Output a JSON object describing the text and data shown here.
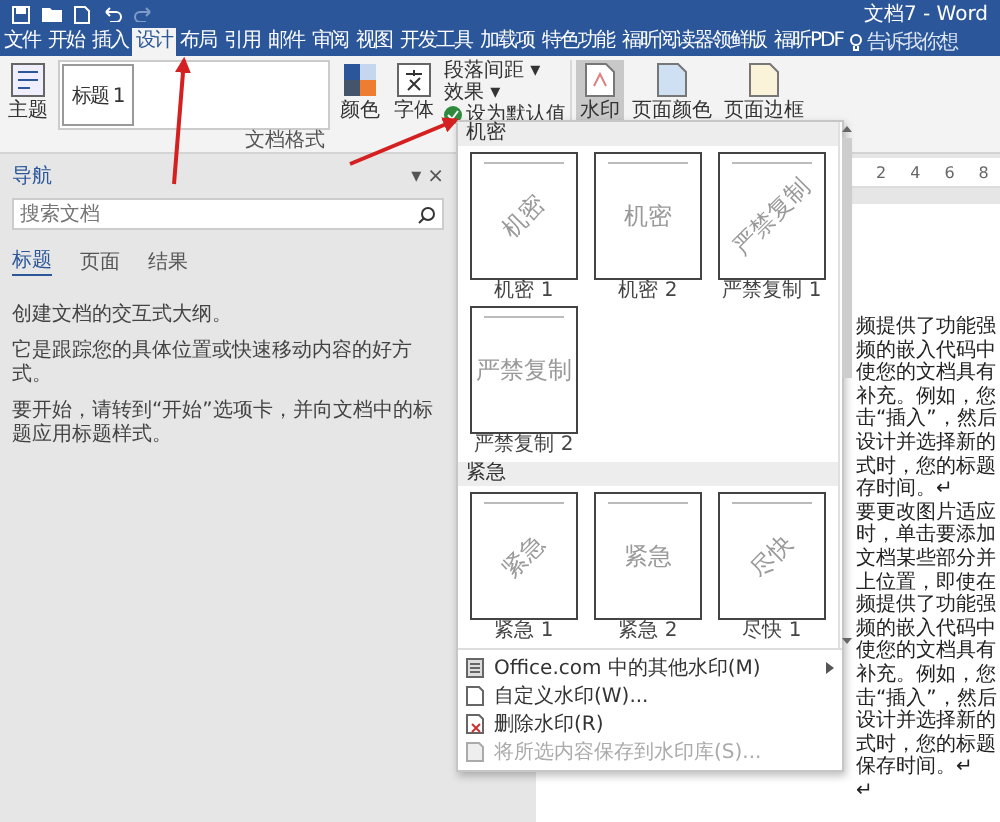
{
  "window": {
    "title": "文档7 - Word"
  },
  "tabs": [
    {
      "label": "文件",
      "selected": false
    },
    {
      "label": "开始",
      "selected": false
    },
    {
      "label": "插入",
      "selected": false
    },
    {
      "label": "设计",
      "selected": true
    },
    {
      "label": "布局",
      "selected": false
    },
    {
      "label": "引用",
      "selected": false
    },
    {
      "label": "邮件",
      "selected": false
    },
    {
      "label": "审阅",
      "selected": false
    },
    {
      "label": "视图",
      "selected": false
    },
    {
      "label": "开发工具",
      "selected": false
    },
    {
      "label": "加载项",
      "selected": false
    },
    {
      "label": "特色功能",
      "selected": false
    },
    {
      "label": "福昕阅读器领鲜版",
      "selected": false
    },
    {
      "label": "福昕PDF",
      "selected": false
    }
  ],
  "tell_me": {
    "placeholder": "告诉我你想"
  },
  "ribbon": {
    "theme_button": "主题",
    "theme_preview": "标题 1",
    "colors_button": "颜色",
    "fonts_button": "字体",
    "paragraph_spacing": "段落间距 ▾",
    "effects": "效果 ▾",
    "set_default": "设为默认值",
    "watermark_button": {
      "label": "水印",
      "pressed": true
    },
    "page_color": "页面颜色",
    "page_borders": "页面边框",
    "group_label": "文档格式"
  },
  "navigation": {
    "title": "导航",
    "options": "▾",
    "close": "×",
    "search": {
      "placeholder": "搜索文档"
    },
    "tabs": [
      {
        "label": "标题",
        "selected": true
      },
      {
        "label": "页面",
        "selected": false
      },
      {
        "label": "结果",
        "selected": false
      }
    ],
    "paragraphs": [
      "创建文档的交互式大纲。",
      "它是跟踪您的具体位置或快速移动内容的好方式。",
      "要开始，请转到“开始”选项卡，并向文档中的标题应用标题样式。"
    ]
  },
  "ruler": [
    "2",
    "4",
    "6",
    "8"
  ],
  "watermark_menu": {
    "sections": [
      {
        "title": "机密",
        "items": [
          {
            "label": "机密 1",
            "watermark": "机密",
            "kind": "diagonal"
          },
          {
            "label": "机密 2",
            "watermark": "机密",
            "kind": "horizontal"
          },
          {
            "label": "严禁复制 1",
            "watermark": "严禁复制",
            "kind": "diagonal"
          },
          {
            "label": "严禁复制 2",
            "watermark": "严禁复制",
            "kind": "horizontal"
          }
        ]
      },
      {
        "title": "紧急",
        "items": [
          {
            "label": "紧急 1",
            "watermark": "紧急",
            "kind": "diagonal"
          },
          {
            "label": "紧急 2",
            "watermark": "紧急",
            "kind": "horizontal"
          },
          {
            "label": "尽快 1",
            "watermark": "尽快",
            "kind": "diagonal"
          }
        ]
      }
    ],
    "commands": [
      {
        "label": "Office.com 中的其他水印(M)",
        "submenu": true,
        "disabled": false,
        "kind": "web"
      },
      {
        "label": "自定义水印(W)...",
        "submenu": false,
        "disabled": false,
        "kind": "custom"
      },
      {
        "label": "删除水印(R)",
        "submenu": false,
        "disabled": false,
        "kind": "remove"
      },
      {
        "label": "将所选内容保存到水印库(S)...",
        "submenu": false,
        "disabled": true,
        "kind": "save"
      }
    ]
  },
  "document": {
    "lines": [
      "频提供了功能强",
      "频的嵌入代码中",
      "使您的文档具有",
      "补充。例如，您",
      "击“插入”，然后",
      "设计并选择新的",
      "式时，您的标题",
      "存时间。↵",
      "要更改图片适应",
      "时，单击要添加",
      "文档某些部分并",
      "上位置，即使在",
      "频提供了功能强",
      "频的嵌入代码中",
      "使您的文档具有",
      "补充。例如，您",
      "击“插入”，然后",
      "设计并选择新的",
      "式时，您的标题",
      "保存时间。↵",
      "↵"
    ]
  }
}
